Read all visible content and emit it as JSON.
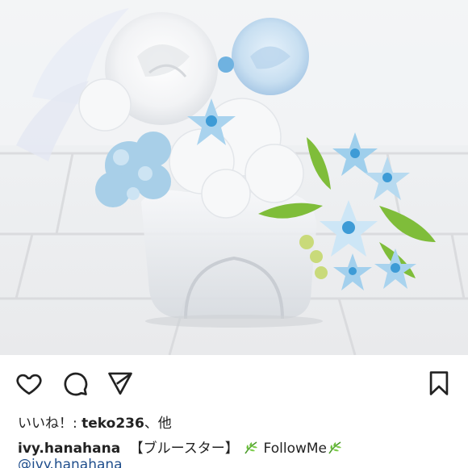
{
  "photo": {
    "subject": "preserved-flower-arrangement"
  },
  "actions": {
    "like_icon": "heart-icon",
    "comment_icon": "comment-bubble-icon",
    "share_icon": "paper-plane-icon",
    "save_icon": "bookmark-icon"
  },
  "likes": {
    "prefix": "いいね！: ",
    "user": "teko236",
    "suffix": "、他"
  },
  "caption": {
    "author": "ivy.hanahana",
    "text_part1": "【ブルースター】",
    "text_part2": " FollowMe",
    "leaf_emoji": "herb-icon"
  },
  "mention": {
    "text": "@ivy.hanahana"
  },
  "colors": {
    "text": "#222222",
    "link": "#1f4e8c",
    "background": "#ffffff"
  }
}
